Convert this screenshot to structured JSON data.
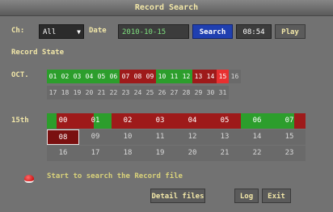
{
  "window": {
    "title": "Record Search"
  },
  "toolbar": {
    "ch_label": "Ch:",
    "ch_value": "All",
    "date_label": "Date",
    "date_value": "2010-10-15",
    "search_label": "Search",
    "time_value": "08:54",
    "play_label": "Play"
  },
  "record_state_label": "Record State",
  "month_label": "OCT.",
  "days": [
    {
      "label": "01",
      "state": "green"
    },
    {
      "label": "02",
      "state": "green"
    },
    {
      "label": "03",
      "state": "green"
    },
    {
      "label": "04",
      "state": "green"
    },
    {
      "label": "05",
      "state": "green"
    },
    {
      "label": "06",
      "state": "green"
    },
    {
      "label": "07",
      "state": "red"
    },
    {
      "label": "08",
      "state": "red"
    },
    {
      "label": "09",
      "state": "red"
    },
    {
      "label": "10",
      "state": "green"
    },
    {
      "label": "11",
      "state": "green"
    },
    {
      "label": "12",
      "state": "green"
    },
    {
      "label": "13",
      "state": "red"
    },
    {
      "label": "14",
      "state": "red"
    },
    {
      "label": "15",
      "state": "sel"
    },
    {
      "label": "16",
      "state": "none"
    },
    {
      "label": "17",
      "state": "none"
    },
    {
      "label": "18",
      "state": "none"
    },
    {
      "label": "19",
      "state": "none"
    },
    {
      "label": "20",
      "state": "none"
    },
    {
      "label": "21",
      "state": "none"
    },
    {
      "label": "22",
      "state": "none"
    },
    {
      "label": "23",
      "state": "none"
    },
    {
      "label": "24",
      "state": "none"
    },
    {
      "label": "25",
      "state": "none"
    },
    {
      "label": "26",
      "state": "none"
    },
    {
      "label": "27",
      "state": "none"
    },
    {
      "label": "28",
      "state": "none"
    },
    {
      "label": "29",
      "state": "none"
    },
    {
      "label": "30",
      "state": "none"
    },
    {
      "label": "31",
      "state": "none"
    }
  ],
  "day_label": "15th",
  "hours": [
    {
      "label": "00",
      "state": "mix"
    },
    {
      "label": "01",
      "state": "mix2"
    },
    {
      "label": "02",
      "state": "red"
    },
    {
      "label": "03",
      "state": "red"
    },
    {
      "label": "04",
      "state": "red"
    },
    {
      "label": "05",
      "state": "red"
    },
    {
      "label": "06",
      "state": "green"
    },
    {
      "label": "07",
      "state": "mix3"
    },
    {
      "label": "08",
      "state": "outline"
    },
    {
      "label": "09",
      "state": "none"
    },
    {
      "label": "10",
      "state": "none"
    },
    {
      "label": "11",
      "state": "none"
    },
    {
      "label": "12",
      "state": "none"
    },
    {
      "label": "13",
      "state": "none"
    },
    {
      "label": "14",
      "state": "none"
    },
    {
      "label": "15",
      "state": "none"
    },
    {
      "label": "16",
      "state": "none"
    },
    {
      "label": "17",
      "state": "none"
    },
    {
      "label": "18",
      "state": "none"
    },
    {
      "label": "19",
      "state": "none"
    },
    {
      "label": "20",
      "state": "none"
    },
    {
      "label": "21",
      "state": "none"
    },
    {
      "label": "22",
      "state": "none"
    },
    {
      "label": "23",
      "state": "none"
    }
  ],
  "status_text": "Start to search the Record file",
  "buttons": {
    "detail": "Detail files",
    "log": "Log",
    "exit": "Exit"
  },
  "colors": {
    "record": "#2c9e2c",
    "alarm": "#9e1a1a",
    "selected": "#e83030",
    "empty": "#6a6a6a"
  }
}
